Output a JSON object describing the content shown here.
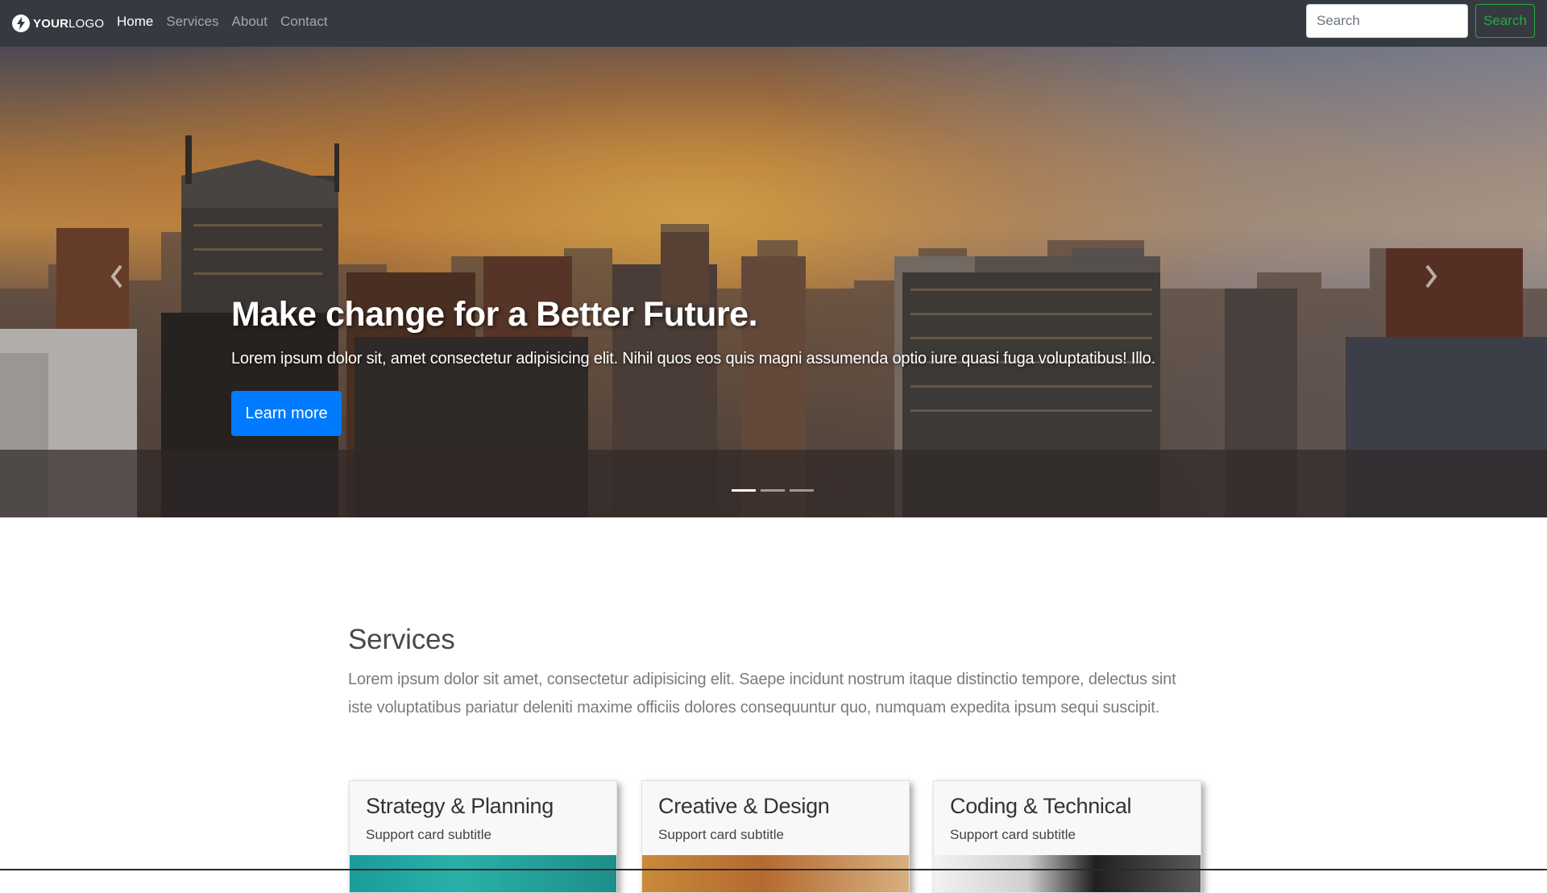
{
  "navbar": {
    "logo_bold": "YOUR",
    "logo_light": "LOGO",
    "links": [
      {
        "label": "Home",
        "active": true
      },
      {
        "label": "Services",
        "active": false
      },
      {
        "label": "About",
        "active": false
      },
      {
        "label": "Contact",
        "active": false
      }
    ],
    "search_placeholder": "Search",
    "search_button": "Search"
  },
  "hero": {
    "title": "Make change for a Better Future.",
    "text": "Lorem ipsum dolor sit, amet consectetur adipisicing elit. Nihil quos eos quis magni assumenda optio iure quasi fuga voluptatibus! Illo.",
    "button": "Learn more",
    "slide_count": 3,
    "active_slide": 1,
    "prev_icon": "chevron-left-icon",
    "next_icon": "chevron-right-icon"
  },
  "services": {
    "title": "Services",
    "text": "Lorem ipsum dolor sit amet, consectetur adipisicing elit. Saepe incidunt nostrum itaque distinctio tempore, delectus sint iste voluptatibus pariatur deleniti maxime officiis dolores consequuntur quo, numquam expedita ipsum sequi suscipit.",
    "cards": [
      {
        "title": "Strategy & Planning",
        "subtitle": "Support card subtitle"
      },
      {
        "title": "Creative & Design",
        "subtitle": "Support card subtitle"
      },
      {
        "title": "Coding & Technical",
        "subtitle": "Support card subtitle"
      }
    ]
  },
  "colors": {
    "navbar_bg": "#343a40",
    "primary": "#007bff",
    "success": "#28a745"
  }
}
